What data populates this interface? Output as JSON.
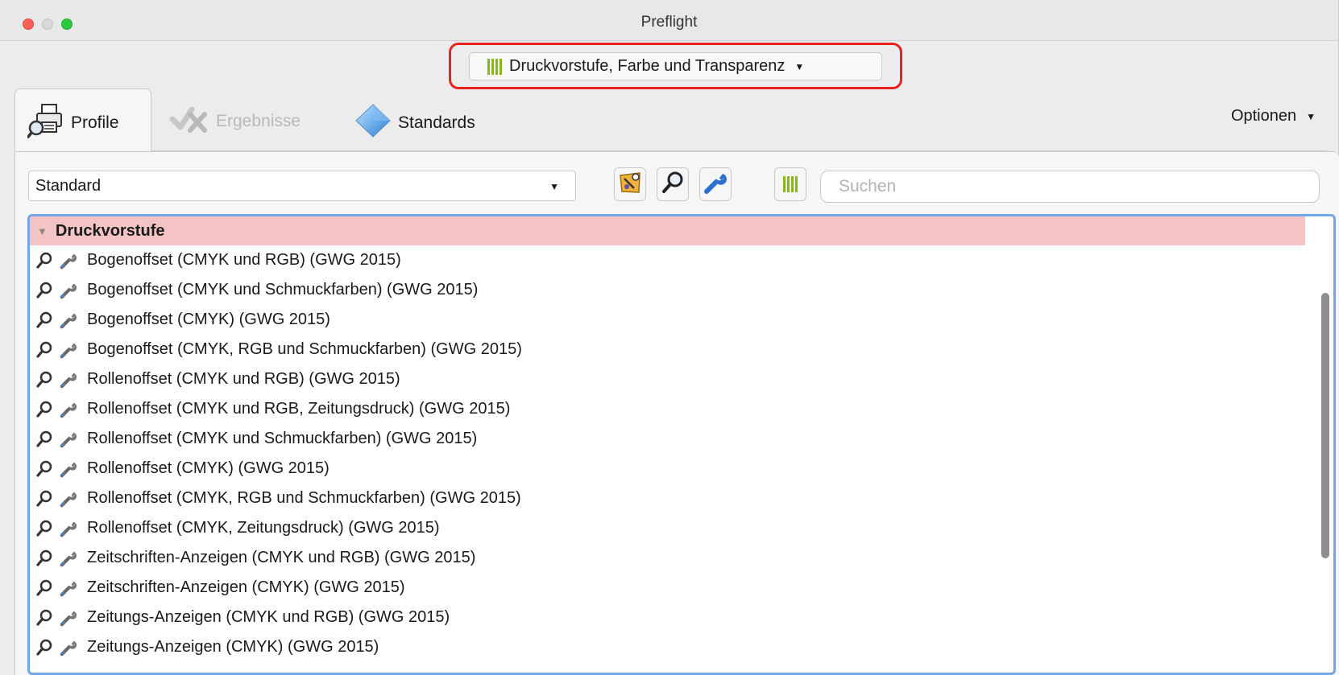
{
  "window": {
    "title": "Preflight"
  },
  "profile_selector": {
    "label": "Druckvorstufe, Farbe und Transparenz"
  },
  "tabs": [
    {
      "label": "Profile",
      "state": "active"
    },
    {
      "label": "Ergebnisse",
      "state": "disabled"
    },
    {
      "label": "Standards",
      "state": "normal"
    }
  ],
  "options_label": "Optionen",
  "filter": {
    "selected": "Standard"
  },
  "search": {
    "placeholder": "Suchen",
    "value": ""
  },
  "list": {
    "group": "Druckvorstufe",
    "items": [
      "Bogenoffset (CMYK und RGB) (GWG 2015)",
      "Bogenoffset (CMYK und Schmuckfarben) (GWG 2015)",
      "Bogenoffset (CMYK) (GWG 2015)",
      "Bogenoffset (CMYK, RGB und Schmuckfarben) (GWG 2015)",
      "Rollenoffset (CMYK und RGB) (GWG 2015)",
      "Rollenoffset (CMYK und RGB, Zeitungsdruck) (GWG 2015)",
      "Rollenoffset (CMYK und Schmuckfarben) (GWG 2015)",
      "Rollenoffset (CMYK) (GWG 2015)",
      "Rollenoffset (CMYK, RGB und Schmuckfarben) (GWG 2015)",
      "Rollenoffset (CMYK, Zeitungsdruck) (GWG 2015)",
      "Zeitschriften-Anzeigen (CMYK und RGB) (GWG 2015)",
      "Zeitschriften-Anzeigen (CMYK) (GWG 2015)",
      "Zeitungs-Anzeigen (CMYK und RGB) (GWG 2015)",
      "Zeitungs-Anzeigen (CMYK) (GWG 2015)"
    ]
  },
  "colors": {
    "accent_green": "#86b81e",
    "highlight_red": "#e8231f",
    "group_bg": "#f4c3c4",
    "focus_blue": "#73a6e5"
  },
  "icons": [
    "printer-magnifier-icon",
    "results-check-icon",
    "standards-diamond-icon",
    "wizard-icon",
    "magnifier-icon",
    "wrench-icon",
    "bars-icon"
  ]
}
